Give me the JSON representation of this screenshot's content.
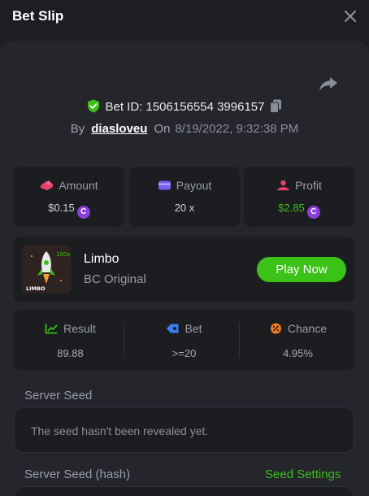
{
  "header": {
    "title": "Bet Slip"
  },
  "bet": {
    "id_text": "Bet ID: 1506156554 3996157",
    "by_label": "By",
    "username": "diasloveu",
    "on_label": "On",
    "timestamp": "8/19/2022, 9:32:38 PM"
  },
  "stats": {
    "amount_label": "Amount",
    "amount_value": "$0.15",
    "payout_label": "Payout",
    "payout_value": "20 x",
    "profit_label": "Profit",
    "profit_value": "$2.85",
    "coin_symbol": "C"
  },
  "game": {
    "name": "Limbo",
    "subtitle": "BC Original",
    "play_label": "Play Now",
    "thumb_text": "LIMBO",
    "thumb_badge": "100x"
  },
  "result": {
    "result_label": "Result",
    "result_value": "89.88",
    "bet_label": "Bet",
    "bet_value": ">=20",
    "chance_label": "Chance",
    "chance_value": "4.95%"
  },
  "seeds": {
    "server_seed_label": "Server Seed",
    "server_seed_value": "The seed hasn't been revealed yet.",
    "server_hash_label": "Server Seed (hash)",
    "seed_settings_label": "Seed Settings"
  },
  "colors": {
    "accent_green": "#3bc117",
    "coin_purple": "#8b3fd9",
    "profit_green": "#3bc117",
    "background": "#1c1e22",
    "card": "#1b1d21"
  }
}
